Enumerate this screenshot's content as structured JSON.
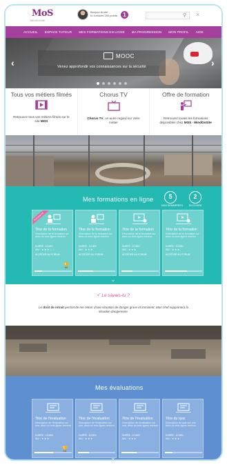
{
  "header": {
    "logo_text": "MoS",
    "logo_sub": "MindOnSite",
    "greeting_line1": "Bonjour André",
    "greeting_line2": "tu cumules 250 points",
    "notification_count": "1",
    "search_placeholder": ""
  },
  "nav": {
    "items": [
      "ACCUEIL",
      "ESPACE TUTEUR",
      "MES FORMATIONS EN LIGNE",
      "MA PROGRESSION",
      "MON PROFIL",
      "AIDE"
    ]
  },
  "hero": {
    "title": "MOOC",
    "subtitle": "Venez approfondir vos connaissances sur la sécurité",
    "prev": "‹",
    "next": "›"
  },
  "info": [
    {
      "title": "Tous vos métiers filmés",
      "desc_pre": "Retrouvez tous vos métiers filmés sur le site ",
      "desc_bold": "MOS",
      "desc_post": ""
    },
    {
      "title": "Chorus TV",
      "desc_pre": "",
      "desc_bold": "Chorus TV",
      "desc_post": ", un autre regard sur votre métier"
    },
    {
      "title": "Offre de formation",
      "desc_pre": "Retrouvez toutes les formations disponibles chez ",
      "desc_bold": "MOS - MindOnSite",
      "desc_post": ""
    }
  ],
  "formations": {
    "title": "Mes formations en ligne",
    "stats": [
      {
        "value": "5",
        "label": "NON DÉMARRÉES"
      },
      {
        "value": "2",
        "label": "EN COURS"
      }
    ],
    "ribbon": "NOUVEAUTÉ",
    "cards": [
      {
        "title": "Titre de la formation",
        "desc": "Description de la formation sur deux ou trois lignes environ",
        "duration": "DURÉE : 10 MIN",
        "level": "NIV. : ★ ★ ★ ☆ ☆",
        "forum": "ACCÉDER AU FORUM",
        "progress": 0.2
      },
      {
        "title": "Titre de la formation",
        "desc": "Description de la formation sur deux ou trois lignes environ",
        "duration": "DURÉE : 10 MIN",
        "level": "NIV. : ★ ★ ★",
        "forum": "ACCÉDER AU FORUM",
        "progress": 0.4
      },
      {
        "title": "Titre de la formation",
        "desc": "Description de la formation sur deux ou trois lignes environ",
        "duration": "DURÉE : 10 MIN",
        "level": "NIV. : ★ ★ ★",
        "forum": "ACCÉDER AU FORUM",
        "progress": 0.3
      },
      {
        "title": "Titre de la formation",
        "desc": "Description de la formation sur deux ou trois lignes environ",
        "duration": "DURÉE : 10 MIN",
        "level": "NIV. : ★ ★ ★",
        "forum": "ACCÉDER AU FORUM",
        "progress": 0.6
      }
    ]
  },
  "savais": {
    "title": "Le savais-tu ?",
    "text_bold": "droit de retrait",
    "text_pre": "Le ",
    "text_post": " permet de me retirer d'une situation de danger grave et imminent. Mon chef supprimera la situation dangereuse."
  },
  "evaluations": {
    "title": "Mes évaluations",
    "cards": [
      {
        "title": "Titre de l'évaluation",
        "desc": "Description de l'évaluation sur une, deux ou trois lignes environ",
        "duration": "DURÉE : 10 MIN",
        "level": "NIV. : ★ ★ ★",
        "progress": 0.5
      },
      {
        "title": "Titre de l'évaluation",
        "desc": "Description de l'évaluation sur une, deux ou trois lignes environ",
        "duration": "DURÉE : 10 MIN",
        "level": "NIV. : ★ ★ ★",
        "progress": 0.3
      },
      {
        "title": "Titre de l'évaluation",
        "desc": "Description de l'évaluation sur une, deux ou trois lignes environ",
        "duration": "DURÉE : 10 MIN",
        "level": "NIV. : ★ ★ ★",
        "progress": 0.4
      },
      {
        "title": "Titre du quiz",
        "desc": "Description du quiz sur une, deux ou trois lignes environ",
        "duration": "DURÉE : 10 MIN",
        "level": "NIV. : ★ ★ ★",
        "progress": 0.2
      }
    ]
  },
  "colors": {
    "nav": "#a4409c",
    "formations": "#25b9b4",
    "evaluations": "#5e8fd1",
    "accent_pink": "#e04a8b"
  }
}
